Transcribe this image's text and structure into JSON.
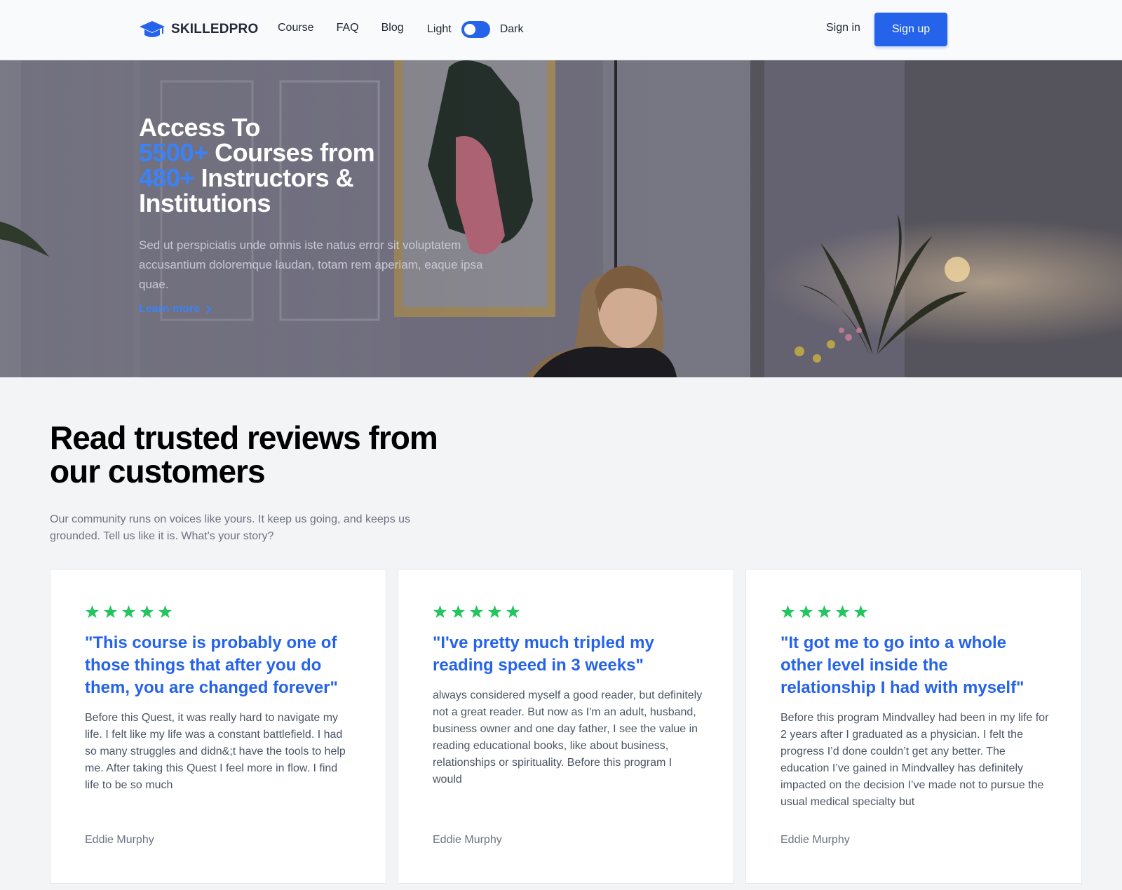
{
  "nav": {
    "brand": "SKILLEDPRO",
    "links": [
      "Course",
      "FAQ",
      "Blog"
    ],
    "theme_light": "Light",
    "theme_dark": "Dark",
    "signin": "Sign in",
    "signup": "Sign up"
  },
  "hero": {
    "line1": "Access To",
    "courses_count": "5500+",
    "courses_text": " Courses from",
    "instructors_count": "480+",
    "instructors_text": " Instructors &",
    "line4": "Institutions",
    "description": "Sed ut perspiciatis unde omnis iste natus error sit voluptatem accusantium doloremque laudan, totam rem aperiam, eaque ipsa quae.",
    "learn_more": "Learn more"
  },
  "reviews": {
    "title": "Read trusted reviews from our customers",
    "subtitle": "Our community runs on voices like yours. It keep us going, and keeps us grounded. Tell us like it is. What's your story?",
    "cards": [
      {
        "rating": 5,
        "quote": "\"This course is probably one of those things that after you do them, you are changed forever\"",
        "body": "Before this Quest, it was really hard to navigate my life. I felt like my life was a constant battlefield. I had so many struggles and didn&;t have the tools to help me. After taking this Quest I feel more in flow. I find life to be so much",
        "author": "Eddie Murphy"
      },
      {
        "rating": 5,
        "quote": "\"I've pretty much tripled my reading speed in 3 weeks\"",
        "body": "always considered myself a good reader, but definitely not a great reader. But now as I'm an adult, husband, business owner and one day father, I see the value in reading educational books, like about business, relationships or spirituality. Before this program I would",
        "author": "Eddie Murphy"
      },
      {
        "rating": 5,
        "quote": "\"It got me to go into a whole other level inside the relationship I had with myself\"",
        "body": "Before this program Mindvalley had been in my life for 2 years after I graduated as a physician. I felt the progress I’d done couldn’t get any better. The education I’ve gained in Mindvalley has definitely impacted on the decision I’ve made not to pursue the usual medical specialty but",
        "author": "Eddie Murphy"
      }
    ]
  },
  "colors": {
    "accent": "#2563eb",
    "star": "#22c55e"
  },
  "icons": {
    "brand": "graduation-cap-icon",
    "learn_more": "chevron-right-icon",
    "rating": "star-icon"
  }
}
